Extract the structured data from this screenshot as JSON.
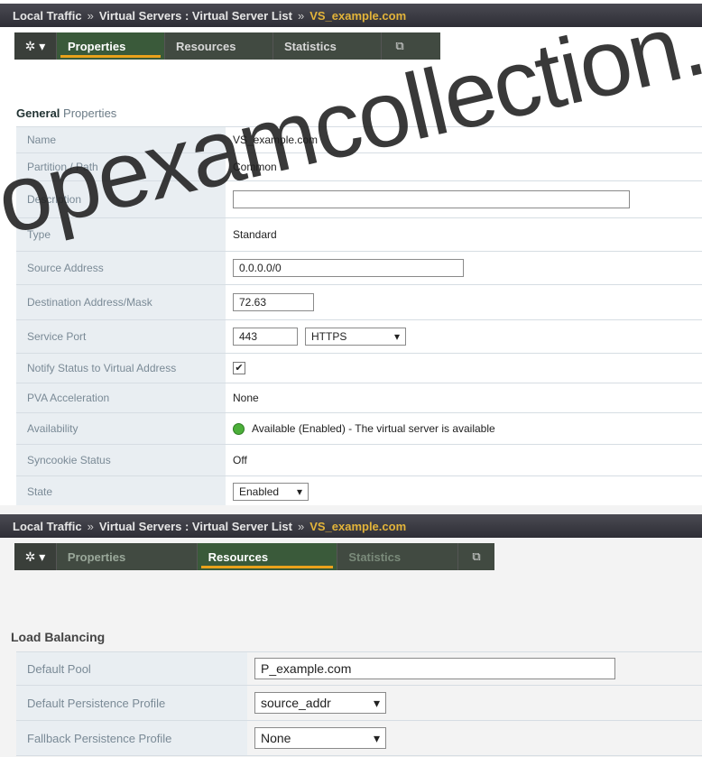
{
  "top": {
    "breadcrumb": {
      "part1": "Local Traffic",
      "sep1": "»",
      "part2": "Virtual Servers : Virtual Server List",
      "sep2": "»",
      "current": "VS_example.com"
    },
    "tabs": [
      {
        "label": "Properties",
        "active": true
      },
      {
        "label": "Resources",
        "active": false
      },
      {
        "label": "Statistics",
        "active": false
      }
    ],
    "gear": "✲ ▾",
    "popout": "⧉"
  },
  "general": {
    "title_bold": "General",
    "title_rest": "Properties",
    "rows": {
      "name": {
        "label": "Name",
        "value": "VS_example.com"
      },
      "partition": {
        "label": "Partition / Path",
        "value": "Common"
      },
      "description": {
        "label": "Description",
        "value": ""
      },
      "type": {
        "label": "Type",
        "value": "Standard"
      },
      "source": {
        "label": "Source Address",
        "value": "0.0.0.0/0"
      },
      "destination": {
        "label": "Destination Address/Mask",
        "value": "72.63"
      },
      "service_port": {
        "label": "Service Port",
        "port": "443",
        "protocol": "HTTPS"
      },
      "notify": {
        "label": "Notify Status to Virtual Address",
        "checked": "✔"
      },
      "pva": {
        "label": "PVA Acceleration",
        "value": "None"
      },
      "availability": {
        "label": "Availability",
        "value": "Available (Enabled) - The virtual server is available"
      },
      "syncookie": {
        "label": "Syncookie Status",
        "value": "Off"
      },
      "state": {
        "label": "State",
        "value": "Enabled"
      }
    }
  },
  "bottom": {
    "breadcrumb": {
      "part1": "Local Traffic",
      "sep1": "»",
      "part2": "Virtual Servers : Virtual Server List",
      "sep2": "»",
      "current": "VS_example.com"
    },
    "tabs": [
      {
        "label": "Properties",
        "active": false
      },
      {
        "label": "Resources",
        "active": true
      },
      {
        "label": "Statistics",
        "active": false
      }
    ],
    "gear": "✲ ▾",
    "popout": "⧉"
  },
  "load_balancing": {
    "title": "Load Balancing",
    "rows": {
      "default_pool": {
        "label": "Default Pool",
        "value": "P_example.com"
      },
      "default_persistence": {
        "label": "Default Persistence Profile",
        "value": "source_addr"
      },
      "fallback_persistence": {
        "label": "Fallback Persistence Profile",
        "value": "None"
      }
    }
  },
  "watermark": "opexamcollection.c",
  "colors": {
    "accent": "#e9a21b",
    "breadcrumb_current": "#e3b43a",
    "status_available": "#4caf3a"
  }
}
